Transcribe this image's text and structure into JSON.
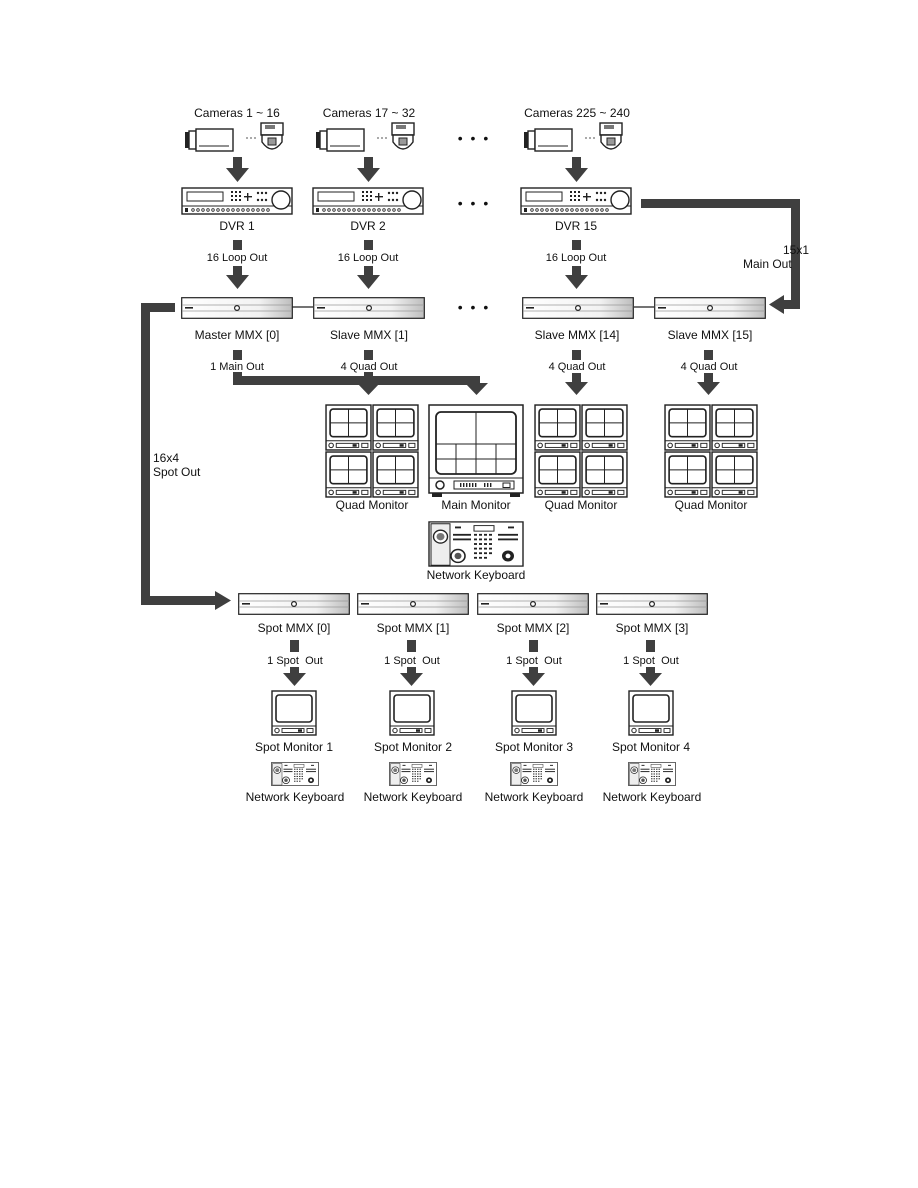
{
  "diagram": {
    "camera_groups": [
      {
        "label": "Cameras 1 ~ 16"
      },
      {
        "label": "Cameras 17 ~ 32"
      },
      {
        "label": "Cameras 225 ~ 240"
      }
    ],
    "dvrs": [
      {
        "label": "DVR 1",
        "loop_out": "16 Loop Out"
      },
      {
        "label": "DVR 2",
        "loop_out": "16 Loop Out"
      },
      {
        "label": "DVR 15",
        "loop_out": "16 Loop Out"
      }
    ],
    "main_out_link": {
      "line1": "15x1",
      "line2": "Main Out"
    },
    "mmx_units": [
      {
        "label": "Master  MMX [0]",
        "output": "1 Main Out"
      },
      {
        "label": "Slave  MMX [1]",
        "output": "4 Quad Out"
      },
      {
        "label": "Slave  MMX [14]",
        "output": "4 Quad Out"
      },
      {
        "label": "Slave  MMX [15]",
        "output": "4 Quad Out"
      }
    ],
    "spot_out_link": {
      "line1": "16x4",
      "line2": "Spot Out"
    },
    "monitors": [
      {
        "label": "Quad Monitor",
        "type": "quad"
      },
      {
        "label": "Main Monitor",
        "type": "main"
      },
      {
        "label": "Quad Monitor",
        "type": "quad"
      },
      {
        "label": "Quad Monitor",
        "type": "quad"
      }
    ],
    "main_keyboard": {
      "label": "Network Keyboard"
    },
    "spot_units": [
      {
        "label": "Spot MMX [0]",
        "output": "1 Spot  Out",
        "monitor": "Spot Monitor 1",
        "keyboard": "Network Keyboard"
      },
      {
        "label": "Spot  MMX [1]",
        "output": "1 Spot  Out",
        "monitor": "Spot Monitor 2",
        "keyboard": "Network Keyboard"
      },
      {
        "label": "Spot  MMX [2]",
        "output": "1 Spot  Out",
        "monitor": "Spot Monitor 3",
        "keyboard": "Network Keyboard"
      },
      {
        "label": "Spot  MMX [3]",
        "output": "1 Spot  Out",
        "monitor": "Spot Monitor 4",
        "keyboard": "Network Keyboard"
      }
    ],
    "ellipsis": "•  •  •",
    "colors": {
      "connector": "#3f3f3f",
      "line": "#222222",
      "background": "#ffffff"
    }
  }
}
